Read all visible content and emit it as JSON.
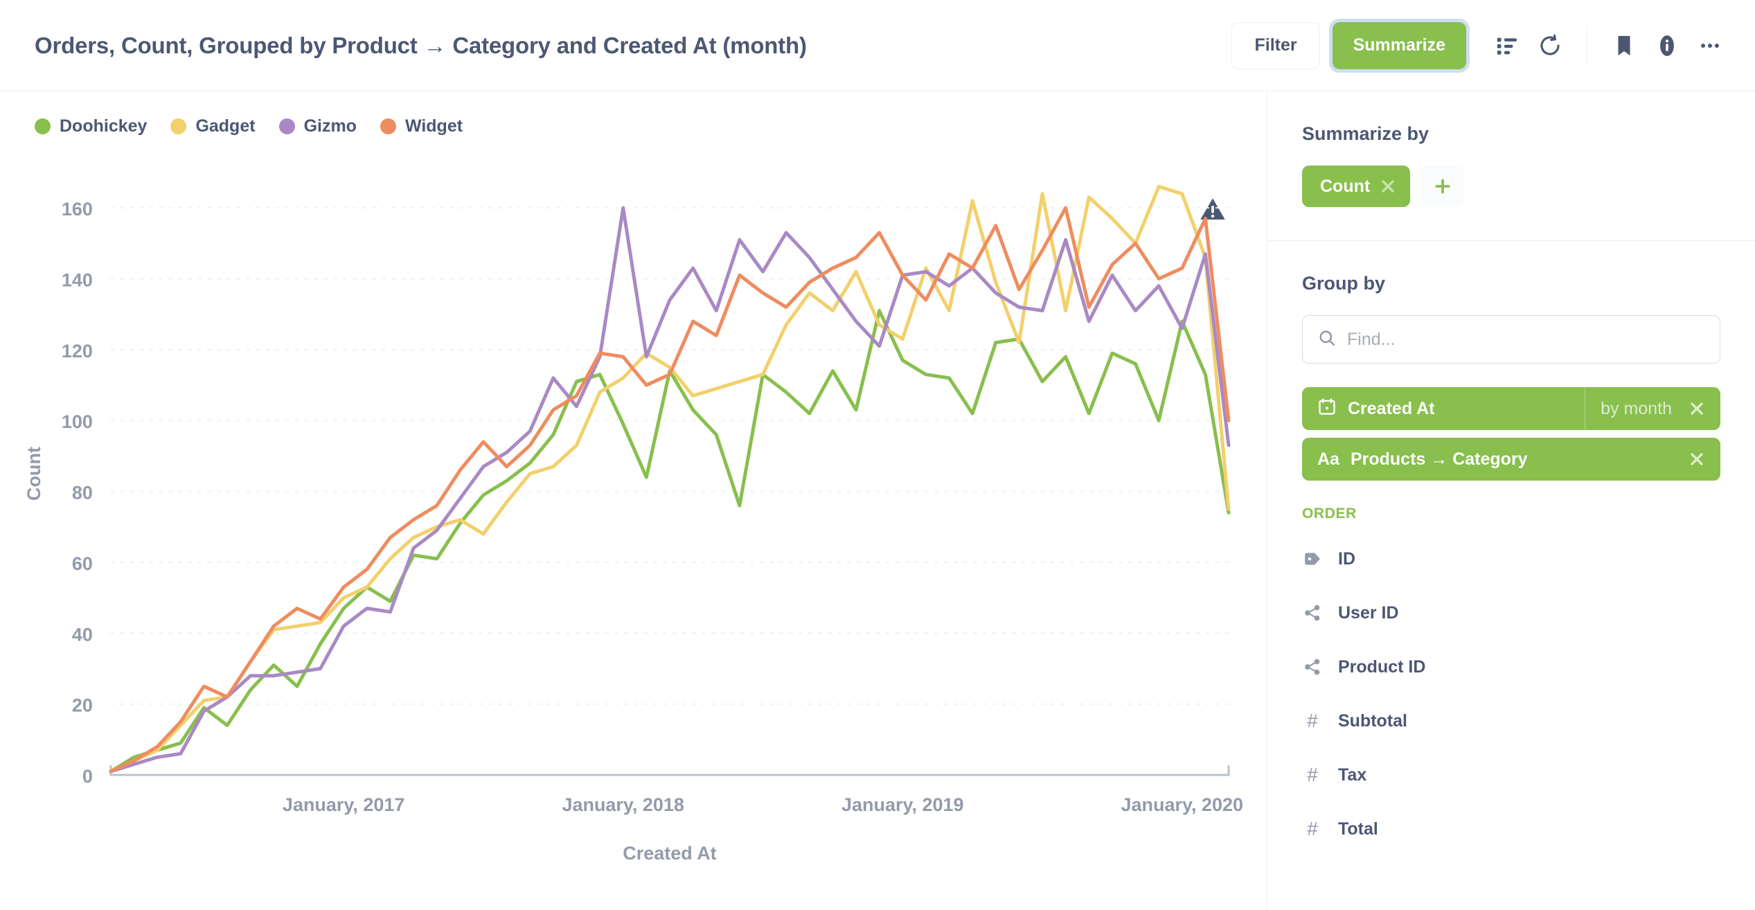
{
  "header": {
    "title": "Orders, Count, Grouped by Product → Category and Created At (month)",
    "filter_label": "Filter",
    "summarize_label": "Summarize",
    "icons": {
      "table_view": "table-list-icon",
      "refresh": "refresh-icon",
      "bookmark": "bookmark-icon",
      "info": "info-icon",
      "more": "ellipsis-icon"
    }
  },
  "chart": {
    "warning_icon": "warning-triangle-icon"
  },
  "sidebar": {
    "summarize_by": {
      "title": "Summarize by",
      "pill_label": "Count",
      "remove_label": "✕",
      "add_label": "+"
    },
    "group_by": {
      "title": "Group by",
      "search_placeholder": "Find...",
      "search_value": "",
      "pills": [
        {
          "label": "Created At",
          "bucket": "by month",
          "icon": "calendar-icon",
          "remove_label": "✕"
        },
        {
          "label": "Products → Category",
          "bucket": "",
          "icon": "text-aa-icon",
          "remove_label": "✕"
        }
      ],
      "section_header": "ORDER",
      "fields": [
        {
          "label": "ID",
          "icon": "tag-icon"
        },
        {
          "label": "User ID",
          "icon": "connection-icon"
        },
        {
          "label": "Product ID",
          "icon": "connection-icon"
        },
        {
          "label": "Subtotal",
          "icon": "number-icon"
        },
        {
          "label": "Tax",
          "icon": "number-icon"
        },
        {
          "label": "Total",
          "icon": "number-icon"
        }
      ]
    }
  },
  "colors": {
    "doohickey": "#88BF4D",
    "gadget": "#F2D06B",
    "gizmo": "#A989C5",
    "widget": "#EF8C5F",
    "brand_green": "#88BF4D",
    "text_dark": "#4C5773",
    "text_muted": "#949AAB",
    "border": "#EDF0F1"
  },
  "chart_data": {
    "type": "line",
    "title": "",
    "xlabel": "Created At",
    "ylabel": "Count",
    "ylim": [
      0,
      170
    ],
    "yticks": [
      0,
      20,
      40,
      60,
      80,
      100,
      120,
      140,
      160
    ],
    "grid": true,
    "legend_position": "top-left",
    "x_tick_labels": [
      "January, 2017",
      "January, 2018",
      "January, 2019",
      "January, 2020"
    ],
    "x_tick_indices": [
      10,
      22,
      34,
      46
    ],
    "x": [
      "2016-04",
      "2016-05",
      "2016-06",
      "2016-07",
      "2016-08",
      "2016-09",
      "2016-10",
      "2016-11",
      "2016-12",
      "2017-01",
      "2017-02",
      "2017-03",
      "2017-04",
      "2017-05",
      "2017-06",
      "2017-07",
      "2017-08",
      "2017-09",
      "2017-10",
      "2017-11",
      "2017-12",
      "2018-01",
      "2018-02",
      "2018-03",
      "2018-04",
      "2018-05",
      "2018-06",
      "2018-07",
      "2018-08",
      "2018-09",
      "2018-10",
      "2018-11",
      "2018-12",
      "2019-01",
      "2019-02",
      "2019-03",
      "2019-04",
      "2019-05",
      "2019-06",
      "2019-07",
      "2019-08",
      "2019-09",
      "2019-10",
      "2019-11",
      "2019-12",
      "2020-01",
      "2020-02",
      "2020-03",
      "2020-04"
    ],
    "series": [
      {
        "name": "Doohickey",
        "color": "#88BF4D",
        "values": [
          1,
          5,
          7,
          9,
          19,
          14,
          24,
          31,
          25,
          37,
          47,
          53,
          49,
          62,
          61,
          71,
          79,
          83,
          88,
          96,
          111,
          113,
          99,
          84,
          114,
          103,
          96,
          76,
          113,
          108,
          102,
          114,
          103,
          131,
          117,
          113,
          112,
          102,
          122,
          123,
          111,
          118,
          102,
          119,
          116,
          100,
          128,
          113,
          74
        ]
      },
      {
        "name": "Gadget",
        "color": "#F2D06B",
        "values": [
          1,
          4,
          7,
          14,
          21,
          22,
          32,
          41,
          42,
          43,
          50,
          53,
          61,
          67,
          70,
          72,
          68,
          77,
          85,
          87,
          93,
          108,
          112,
          119,
          115,
          107,
          109,
          111,
          113,
          127,
          136,
          131,
          142,
          127,
          123,
          143,
          131,
          162,
          139,
          122,
          164,
          131,
          163,
          157,
          150,
          166,
          164,
          146,
          75
        ]
      },
      {
        "name": "Gizmo",
        "color": "#A989C5",
        "values": [
          1,
          3,
          5,
          6,
          18,
          22,
          28,
          28,
          29,
          30,
          42,
          47,
          46,
          64,
          69,
          78,
          87,
          91,
          97,
          112,
          104,
          118,
          160,
          118,
          134,
          143,
          131,
          151,
          142,
          153,
          146,
          137,
          128,
          121,
          141,
          142,
          138,
          143,
          136,
          132,
          131,
          151,
          128,
          141,
          131,
          138,
          126,
          147,
          93
        ]
      },
      {
        "name": "Widget",
        "color": "#EF8C5F",
        "values": [
          1,
          4,
          8,
          15,
          25,
          22,
          32,
          42,
          47,
          44,
          53,
          58,
          67,
          72,
          76,
          86,
          94,
          87,
          93,
          103,
          107,
          119,
          118,
          110,
          113,
          128,
          124,
          141,
          136,
          132,
          139,
          143,
          146,
          153,
          141,
          134,
          147,
          143,
          155,
          137,
          148,
          160,
          132,
          144,
          150,
          140,
          143,
          157,
          100
        ]
      }
    ]
  }
}
